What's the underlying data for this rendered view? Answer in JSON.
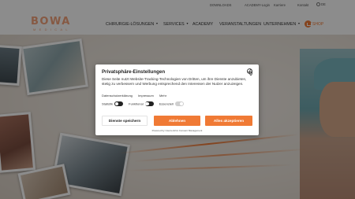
{
  "header": {
    "logo_text": "BOWA",
    "logo_subtext": "MEDICAL",
    "top_nav": [
      "DOWNLOADS",
      "ACADEMY-Login",
      "Karriere",
      "Kontakt"
    ],
    "language": "DE",
    "main_nav": [
      {
        "label": "CHIRURGIE-LÖSUNGEN",
        "dropdown": true
      },
      {
        "label": "SERVICES",
        "dropdown": true
      },
      {
        "label": "ACADEMY",
        "dropdown": false
      },
      {
        "label": "VERANSTALTUNGEN",
        "dropdown": false
      },
      {
        "label": "UNTERNEHMEN",
        "dropdown": true
      }
    ],
    "shop_label": "SHOP"
  },
  "consent": {
    "title": "Privatsphäre-Einstellungen",
    "text": "Diese Seite nutzt Website-Tracking-Technologien von Dritten, um ihre Dienste anzubieten, stetig zu verbessern und Werbung entsprechend den Interessen der Nutzer anzuzeigen.",
    "links": [
      "Datenschutzerklärung",
      "Impressum",
      "Mehr"
    ],
    "toggles": [
      {
        "label": "Statistik",
        "on": false
      },
      {
        "label": "Funktional",
        "on": false
      },
      {
        "label": "Essenziell",
        "on": true
      }
    ],
    "buttons": {
      "save": "Dienste speichern",
      "deny": "Ablehnen",
      "accept": "Alles akzeptieren"
    },
    "powered_by": "Powered by Usercentrics Consent Management"
  },
  "colors": {
    "accent": "#f07a35",
    "logo": "#f4a27a"
  }
}
